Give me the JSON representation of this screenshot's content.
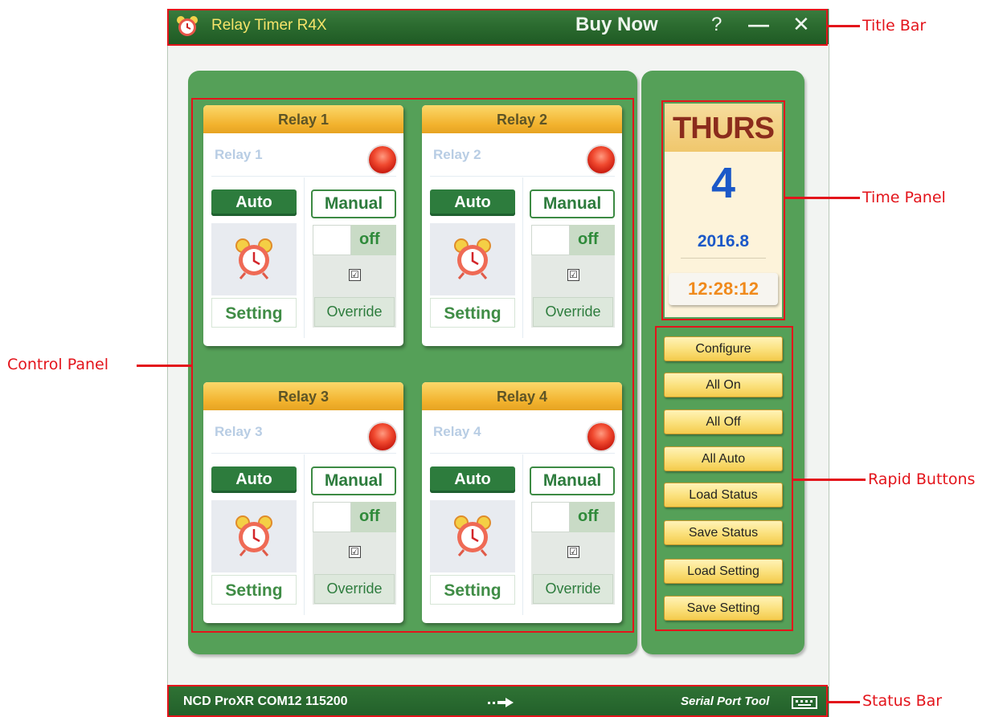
{
  "titlebar": {
    "title": "Relay Timer R4X",
    "buy_now": "Buy Now",
    "help": "?",
    "minimize": "—",
    "close": "✕"
  },
  "relays": [
    {
      "header": "Relay 1",
      "name": "Relay 1",
      "auto": "Auto",
      "manual": "Manual",
      "toggle": "off",
      "setting": "Setting",
      "override": "Override",
      "checkbox": "☑"
    },
    {
      "header": "Relay 2",
      "name": "Relay 2",
      "auto": "Auto",
      "manual": "Manual",
      "toggle": "off",
      "setting": "Setting",
      "override": "Override",
      "checkbox": "☑"
    },
    {
      "header": "Relay 3",
      "name": "Relay 3",
      "auto": "Auto",
      "manual": "Manual",
      "toggle": "off",
      "setting": "Setting",
      "override": "Override",
      "checkbox": "☑"
    },
    {
      "header": "Relay 4",
      "name": "Relay 4",
      "auto": "Auto",
      "manual": "Manual",
      "toggle": "off",
      "setting": "Setting",
      "override": "Override",
      "checkbox": "☑"
    }
  ],
  "time_panel": {
    "day": "THURS",
    "date": "4",
    "month": "2016.8",
    "time": "12:28:12"
  },
  "rapid_buttons": [
    "Configure",
    "All On",
    "All Off",
    "All Auto",
    "Load Status",
    "Save Status",
    "Load Setting",
    "Save Setting"
  ],
  "statusbar": {
    "connection": "NCD ProXR COM12 115200",
    "tool": "Serial Port Tool"
  },
  "annotations": {
    "title_bar": "Title Bar",
    "time_panel": "Time Panel",
    "control_panel": "Control Panel",
    "rapid_buttons": "Rapid Buttons",
    "status_bar": "Status Bar"
  },
  "colors": {
    "frame_green": "#2c6c30",
    "panel_green": "#55a058",
    "header_gold": "#f2b22d",
    "annotation_red": "#e3141b"
  }
}
